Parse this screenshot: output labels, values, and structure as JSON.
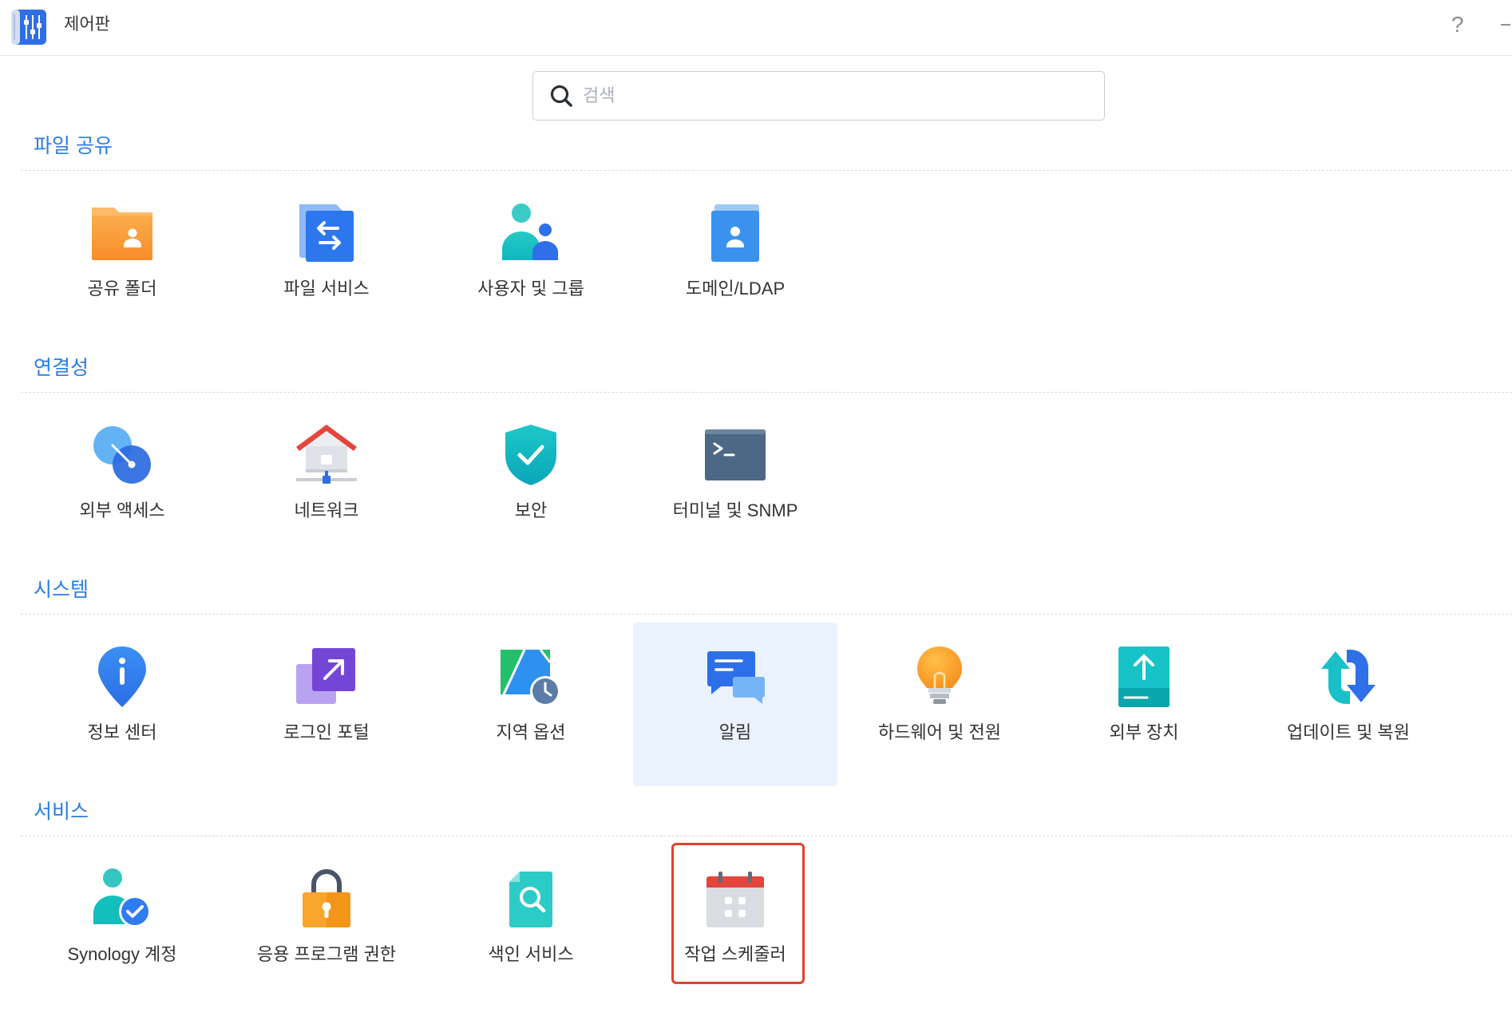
{
  "window": {
    "title": "제어판",
    "help_label": "?"
  },
  "search": {
    "placeholder": "검색"
  },
  "sections": [
    {
      "title": "파일 공유",
      "items": [
        {
          "label": "공유 폴더",
          "icon": "shared-folder-icon"
        },
        {
          "label": "파일 서비스",
          "icon": "file-services-icon"
        },
        {
          "label": "사용자 및 그룹",
          "icon": "users-groups-icon"
        },
        {
          "label": "도메인/LDAP",
          "icon": "domain-ldap-icon"
        }
      ]
    },
    {
      "title": "연결성",
      "items": [
        {
          "label": "외부 액세스",
          "icon": "external-access-icon"
        },
        {
          "label": "네트워크",
          "icon": "network-icon"
        },
        {
          "label": "보안",
          "icon": "security-shield-icon"
        },
        {
          "label": "터미널 및 SNMP",
          "icon": "terminal-icon"
        }
      ]
    },
    {
      "title": "시스템",
      "items": [
        {
          "label": "정보 센터",
          "icon": "info-center-icon"
        },
        {
          "label": "로그인 포털",
          "icon": "login-portal-icon"
        },
        {
          "label": "지역 옵션",
          "icon": "regional-options-icon"
        },
        {
          "label": "알림",
          "icon": "notification-icon",
          "selected": true
        },
        {
          "label": "하드웨어 및 전원",
          "icon": "hardware-power-icon"
        },
        {
          "label": "외부 장치",
          "icon": "external-devices-icon"
        },
        {
          "label": "업데이트 및 복원",
          "icon": "update-restore-icon"
        }
      ]
    },
    {
      "title": "서비스",
      "items": [
        {
          "label": "Synology 계정",
          "icon": "synology-account-icon"
        },
        {
          "label": "응용 프로그램 권한",
          "icon": "application-privileges-icon"
        },
        {
          "label": "색인 서비스",
          "icon": "indexing-service-icon"
        },
        {
          "label": "작업 스케줄러",
          "icon": "task-scheduler-icon",
          "annotated": true
        }
      ]
    }
  ],
  "colors": {
    "section_title": "#2d7ce3",
    "selected_tile_bg": "#eaf2fd",
    "annotation_border": "#e2412f",
    "text": "#333333"
  }
}
